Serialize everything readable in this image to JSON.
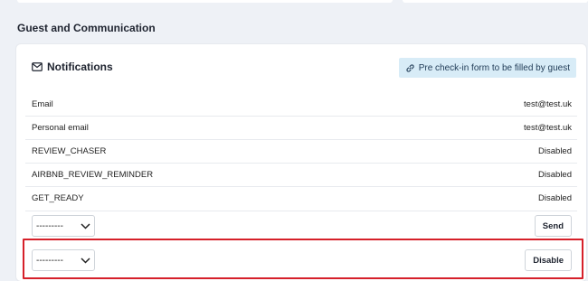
{
  "section": {
    "title": "Guest and Communication"
  },
  "card": {
    "title": "Notifications",
    "title_icon": "envelope-icon",
    "precheck_link": {
      "label": "Pre check-in form to be filled by guest",
      "icon": "link-icon"
    }
  },
  "rows": [
    {
      "label": "Email",
      "value": "test@test.uk"
    },
    {
      "label": "Personal email",
      "value": "test@test.uk"
    },
    {
      "label": "REVIEW_CHASER",
      "value": "Disabled"
    },
    {
      "label": "AIRBNB_REVIEW_REMINDER",
      "value": "Disabled"
    },
    {
      "label": "GET_READY",
      "value": "Disabled"
    }
  ],
  "send_row": {
    "select_value": "---------",
    "button_label": "Send"
  },
  "disable_row": {
    "select_value": "---------",
    "button_label": "Disable"
  },
  "colors": {
    "highlight": "#d6202a",
    "background": "#eef1f6",
    "link_badge": "#d8ecf7"
  }
}
